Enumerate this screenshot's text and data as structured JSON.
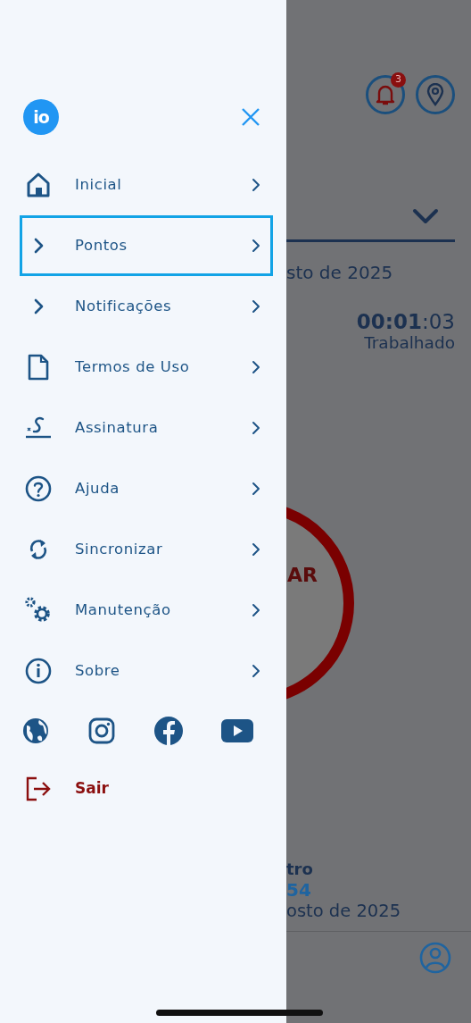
{
  "drawer": {
    "logo": "io",
    "items": [
      {
        "label": "Inicial",
        "selected": false
      },
      {
        "label": "Pontos",
        "selected": true
      },
      {
        "label": "Notificações",
        "selected": false
      },
      {
        "label": "Termos de Uso",
        "selected": false
      },
      {
        "label": "Assinatura",
        "selected": false
      },
      {
        "label": "Ajuda",
        "selected": false
      },
      {
        "label": "Sincronizar",
        "selected": false
      },
      {
        "label": "Manutenção",
        "selected": false
      },
      {
        "label": "Sobre",
        "selected": false
      }
    ],
    "logout": "Sair"
  },
  "background": {
    "notification_count": "3",
    "date_fragment": "sto de 2025",
    "timer_bold": "00:01",
    "timer_rest": ":03",
    "timer_label": "Trabalhado",
    "button_fragment": "AR",
    "record_fragment": "tro",
    "time_fragment": "54",
    "date_fragment_bottom": "osto de 2025"
  }
}
